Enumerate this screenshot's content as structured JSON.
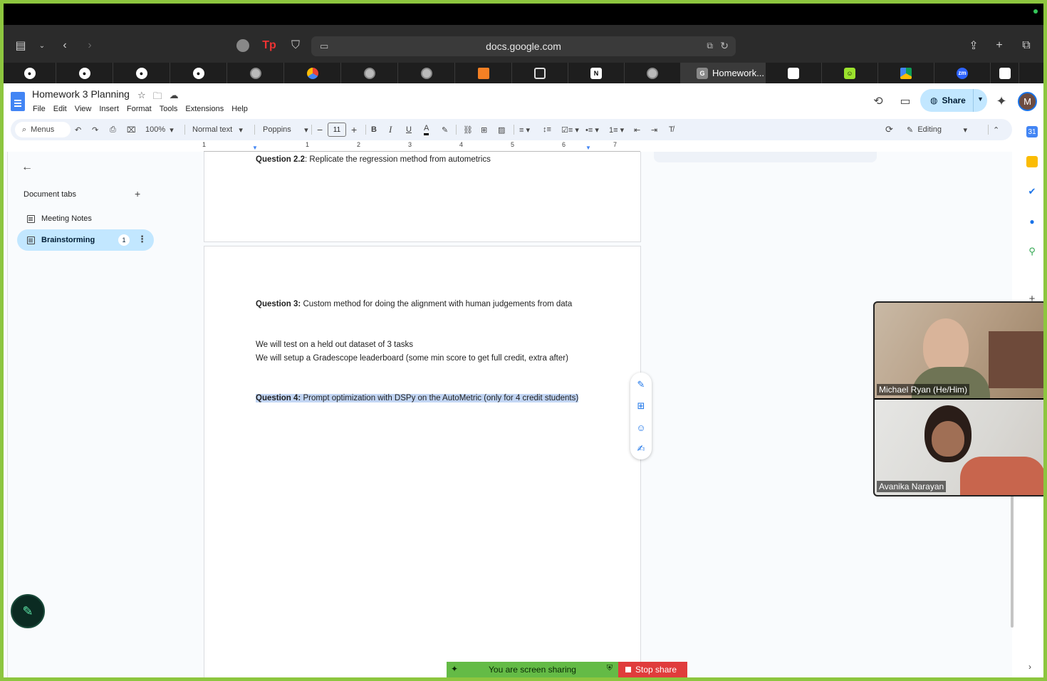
{
  "browser": {
    "url": "docs.google.com",
    "active_tab_label": "Homework...",
    "tab_favicons": [
      "github-icon",
      "github-icon",
      "github-icon",
      "github-icon",
      "gear-icon",
      "gcloud-icon",
      "gear-icon",
      "gear-icon",
      "stackoverflow-icon",
      "canvas-icon",
      "notion-icon",
      "gear-icon",
      "docs-tab",
      "notebook-icon",
      "smile-icon",
      "drive-icon",
      "zoom-icon",
      "notebook-icon"
    ],
    "zoom_label": "zm"
  },
  "doc": {
    "title": "Homework 3 Planning",
    "menus": [
      "File",
      "Edit",
      "View",
      "Insert",
      "Format",
      "Tools",
      "Extensions",
      "Help"
    ],
    "share_label": "Share",
    "avatar_letter": "M"
  },
  "toolbar": {
    "search_label": "Menus",
    "zoom": "100%",
    "style": "Normal text",
    "font": "Poppins",
    "font_size": "11",
    "mode": "Editing"
  },
  "ruler": {
    "numbers": [
      "1",
      "1",
      "2",
      "3",
      "4",
      "5",
      "6",
      "7"
    ]
  },
  "sidebar": {
    "title": "Document tabs",
    "tabs": [
      {
        "label": "Meeting Notes"
      },
      {
        "label": "Brainstorming",
        "badge": "1"
      }
    ]
  },
  "content": {
    "q22_bold": "Question 2.2",
    "q22_text": ": Replicate the regression method from autometrics",
    "q3_bold": "Question 3:",
    "q3_text": " Custom method for doing the alignment with human judgements from data",
    "line_test": "We will test on a held out dataset of 3 tasks",
    "line_setup": "We will setup a Gradescope leaderboard (some min score to get full credit, extra after)",
    "q4_bold": "Question 4:",
    "q4_text": " Prompt optimization with DSPy on the AutoMetric (only for 4 credit students)"
  },
  "video": {
    "participant1": "Michael Ryan (He/Him)",
    "participant2": "Avanika Narayan"
  },
  "screenshare": {
    "status": "You are screen sharing",
    "stop_label": "Stop share"
  },
  "colors": {
    "accent": "#1a73e8",
    "share_bg": "#c2e7ff",
    "highlight": "#c3d6f4",
    "banner_green": "#64bb46",
    "banner_red": "#e03c3c",
    "outer_frame": "#8dc63f"
  }
}
